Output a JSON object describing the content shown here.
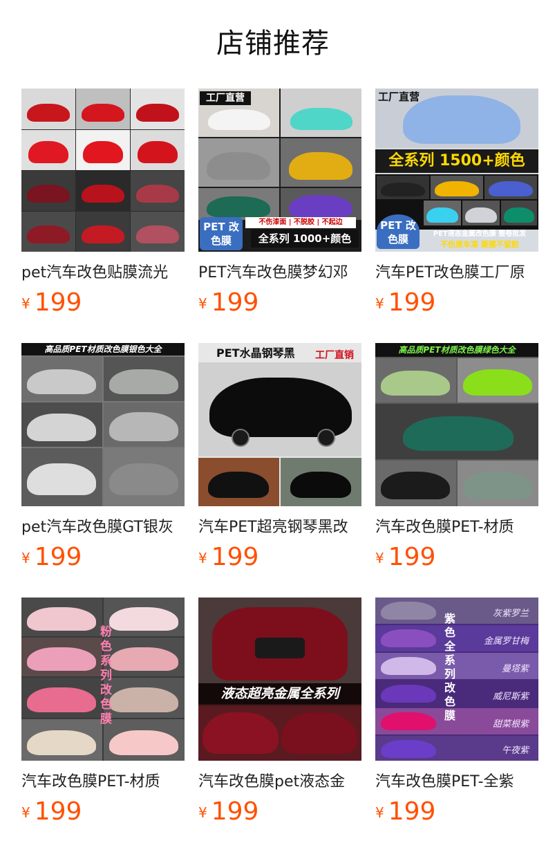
{
  "page": {
    "title": "店铺推荐"
  },
  "products": [
    {
      "name": "pet汽车改色贴膜流光",
      "currency": "¥",
      "price": "199",
      "image": {
        "banner_top": "",
        "banner_mid": "",
        "tag": "",
        "lines": []
      }
    },
    {
      "name": "PET汽车改色膜梦幻邓",
      "currency": "¥",
      "price": "199",
      "image": {
        "banner_top": "工厂直营",
        "banner_mid": "全系列 1000+颜色",
        "tag": "PET 改色膜",
        "lines": [
          "不伤漆面 | 不脱胶 | 不起边"
        ]
      }
    },
    {
      "name": "汽车PET改色膜工厂原",
      "currency": "¥",
      "price": "199",
      "image": {
        "banner_top": "工厂直营",
        "banner_mid": "全系列 1500+颜色",
        "tag": "PET 改色膜",
        "lines": [
          "PET液态金属改色膜 整卷批发",
          "不伤原车漆 撕膜不留胶"
        ]
      }
    },
    {
      "name": "pet汽车改色膜GT银灰",
      "currency": "¥",
      "price": "199",
      "image": {
        "banner_top": "高品质PET材质改色膜银色大全",
        "banner_mid": "",
        "tag": "",
        "lines": []
      }
    },
    {
      "name": "汽车PET超亮钢琴黑改",
      "currency": "¥",
      "price": "199",
      "image": {
        "banner_top": "PET水晶钢琴黑",
        "banner_mid": "工厂直销",
        "tag": "",
        "lines": []
      }
    },
    {
      "name": "汽车改色膜PET-材质",
      "currency": "¥",
      "price": "199",
      "image": {
        "banner_top": "高品质PET材质改色膜绿色大全",
        "banner_mid": "",
        "tag": "",
        "lines": []
      }
    },
    {
      "name": "汽车改色膜PET-材质",
      "currency": "¥",
      "price": "199",
      "image": {
        "banner_top": "",
        "banner_mid": "",
        "tag": "粉色系列改色膜",
        "lines": []
      }
    },
    {
      "name": "汽车改色膜pet液态金",
      "currency": "¥",
      "price": "199",
      "image": {
        "banner_top": "",
        "banner_mid": "液态超亮金属全系列",
        "tag": "",
        "lines": []
      }
    },
    {
      "name": "汽车改色膜PET-全紫",
      "currency": "¥",
      "price": "199",
      "image": {
        "banner_top": "",
        "banner_mid": "",
        "tag": "紫色全系列改色膜",
        "lines": [
          "灰紫罗兰",
          "金属罗甘梅",
          "曼塔紫",
          "威尼斯紫",
          "甜菜根紫",
          "午夜紫"
        ]
      }
    }
  ],
  "colors": {
    "price": "#ff5000",
    "title": "#111111"
  }
}
